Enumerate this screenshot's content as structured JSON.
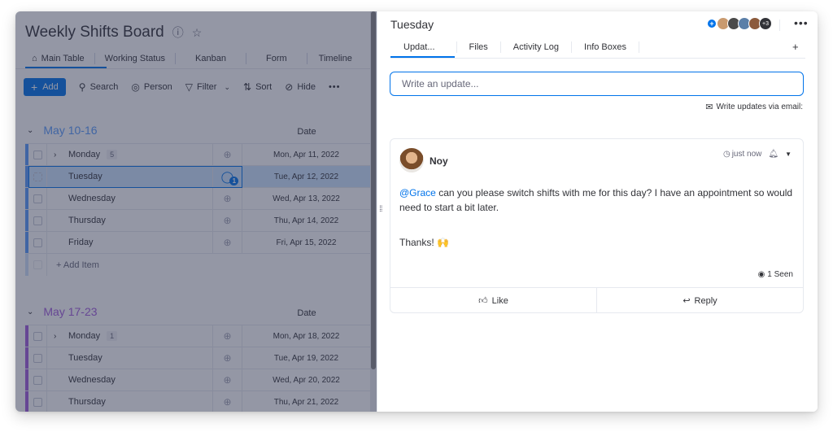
{
  "board": {
    "title": "Weekly Shifts Board",
    "title_icons": [
      "info-icon",
      "star-icon"
    ],
    "view_tabs": [
      {
        "label": "Main Table",
        "icon": "home-icon",
        "active": true
      },
      {
        "label": "Working Status"
      },
      {
        "label": "Kanban"
      },
      {
        "label": "Form"
      },
      {
        "label": "Timeline"
      }
    ],
    "toolbar": {
      "add_label": "Add",
      "search_label": "Search",
      "person_label": "Person",
      "filter_label": "Filter",
      "sort_label": "Sort",
      "hide_label": "Hide",
      "more_label": "•••"
    },
    "groups": [
      {
        "title": "May 10-16",
        "color": "#579bfc",
        "date_col": "Date",
        "rows": [
          {
            "name": "Monday",
            "subitems": "5",
            "date": "Mon, Apr 11, 2022"
          },
          {
            "name": "Tuesday",
            "date": "Tue, Apr 12, 2022",
            "selected": true,
            "updates": "1"
          },
          {
            "name": "Wednesday",
            "date": "Wed, Apr 13, 2022"
          },
          {
            "name": "Thursday",
            "date": "Thu, Apr 14, 2022"
          },
          {
            "name": "Friday",
            "date": "Fri, Apr 15, 2022"
          }
        ],
        "add_item": "+ Add Item"
      },
      {
        "title": "May 17-23",
        "color": "#a25ddc",
        "date_col": "Date",
        "rows": [
          {
            "name": "Monday",
            "subitems": "1",
            "date": "Mon, Apr 18, 2022"
          },
          {
            "name": "Tuesday",
            "date": "Tue, Apr 19, 2022"
          },
          {
            "name": "Wednesday",
            "date": "Wed, Apr 20, 2022"
          },
          {
            "name": "Thursday",
            "date": "Thu, Apr 21, 2022"
          }
        ]
      }
    ]
  },
  "panel": {
    "title": "Tuesday",
    "avatars_more": "+3",
    "more_label": "•••",
    "tabs": [
      {
        "label": "Updat...",
        "active": true
      },
      {
        "label": "Files"
      },
      {
        "label": "Activity Log"
      },
      {
        "label": "Info Boxes"
      }
    ],
    "add_tab": "+",
    "update_placeholder": "Write an update...",
    "email_link": "Write updates via email:",
    "post": {
      "author": "Noy",
      "time": "just now",
      "mention": "@Grace",
      "body": " can you please switch shifts with me for this day? I have an appointment so would need to start a bit later.",
      "thanks": "Thanks! 🙌",
      "seen": "1 Seen",
      "like_label": "Like",
      "reply_label": "Reply"
    }
  }
}
